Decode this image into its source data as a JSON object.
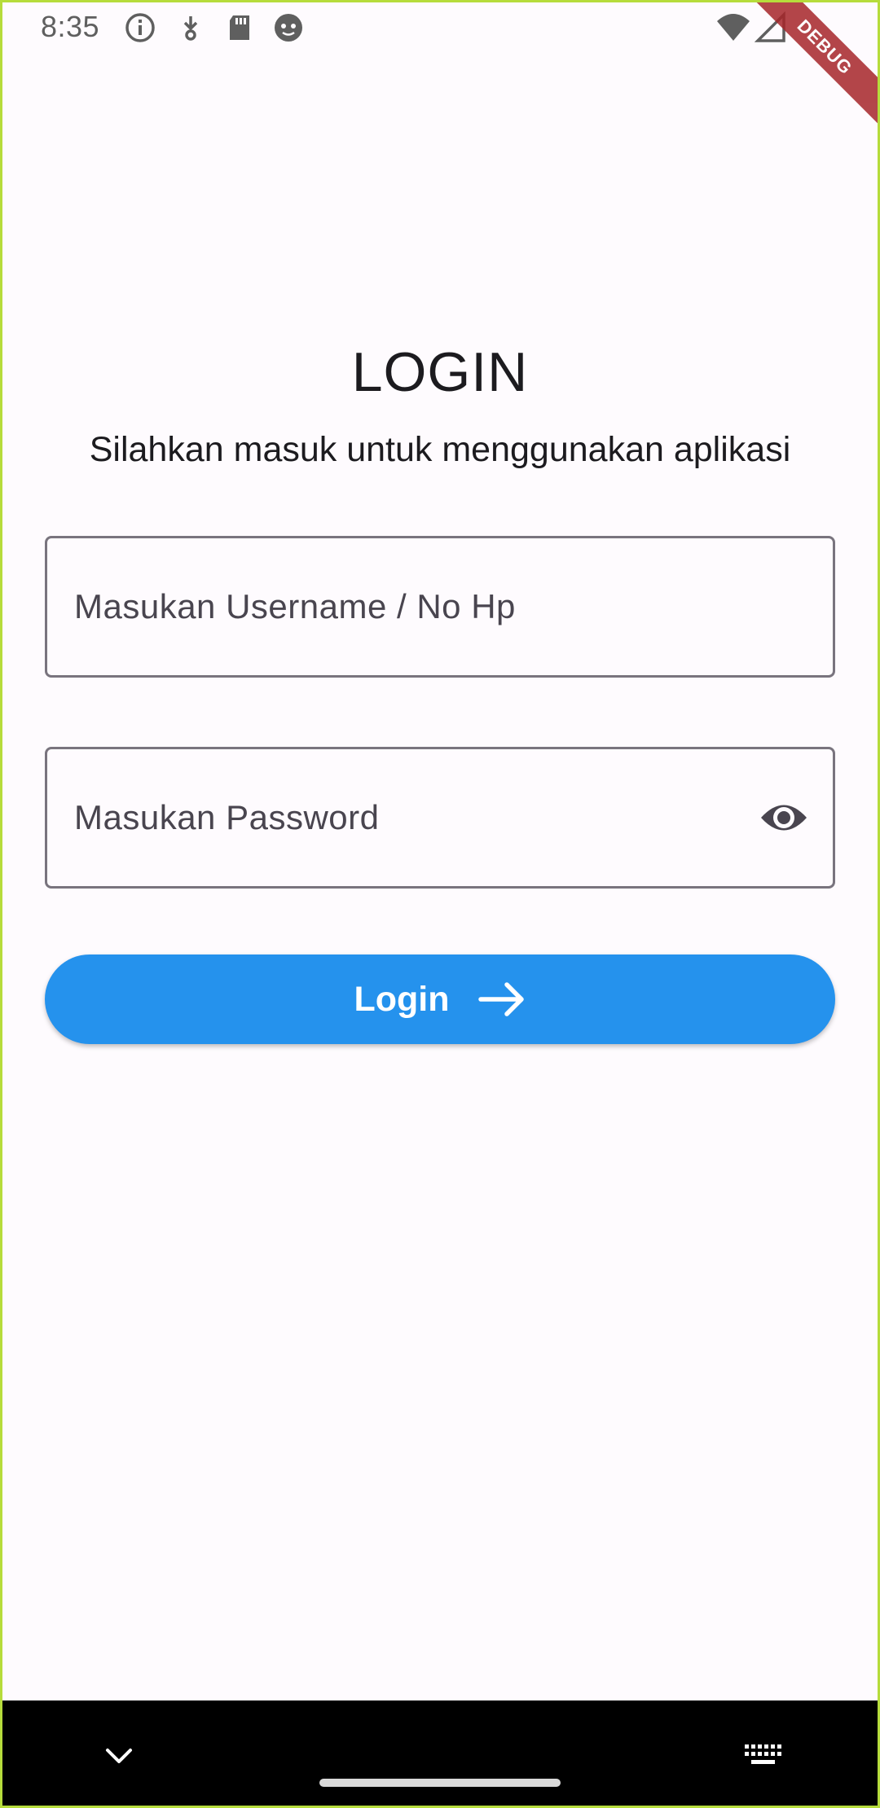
{
  "status_bar": {
    "time": "8:35",
    "left_icons": [
      "info-icon",
      "download-arrow-icon",
      "sd-card-icon",
      "face-icon"
    ],
    "right_icons": [
      "wifi-icon",
      "signal-icon"
    ]
  },
  "debug_banner": "DEBUG",
  "login": {
    "title": "LOGIN",
    "subtitle": "Silahkan masuk untuk menggunakan aplikasi",
    "username_placeholder": "Masukan Username / No Hp",
    "password_placeholder": "Masukan Password",
    "button_label": "Login"
  },
  "colors": {
    "background": "#fefbfe",
    "primary": "#2592ed",
    "outline": "#79747e",
    "text": "#1c1b1f",
    "debug": "#a6262a"
  },
  "nav_bar": {
    "icons": [
      "chevron-down-icon",
      "home-handle",
      "keyboard-icon"
    ]
  }
}
